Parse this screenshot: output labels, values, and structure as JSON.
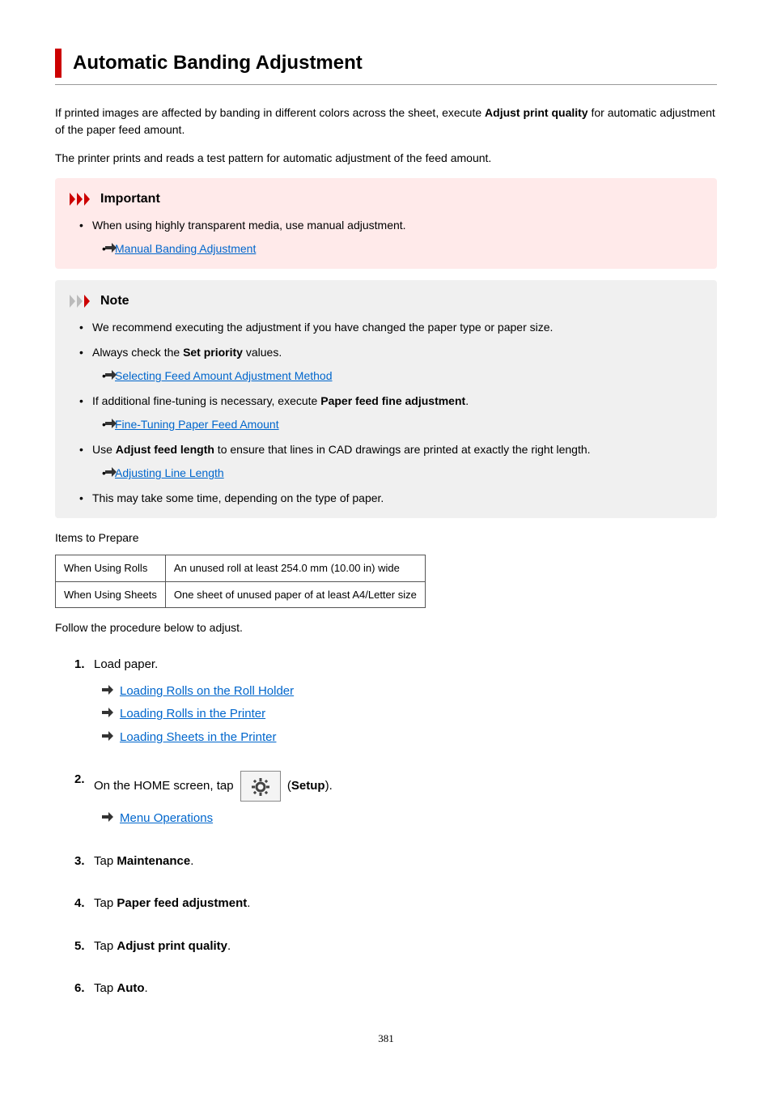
{
  "title": "Automatic Banding Adjustment",
  "intro1_a": "If printed images are affected by banding in different colors across the sheet, execute ",
  "intro1_b": "Adjust print quality",
  "intro1_c": " for automatic adjustment of the paper feed amount.",
  "intro2": "The printer prints and reads a test pattern for automatic adjustment of the feed amount.",
  "important": {
    "label": "Important",
    "item1": "When using highly transparent media, use manual adjustment.",
    "link1": "Manual Banding Adjustment"
  },
  "note": {
    "label": "Note",
    "item1": "We recommend executing the adjustment if you have changed the paper type or paper size.",
    "item2_a": "Always check the ",
    "item2_b": "Set priority",
    "item2_c": " values.",
    "link2": "Selecting Feed Amount Adjustment Method",
    "item3_a": "If additional fine-tuning is necessary, execute ",
    "item3_b": "Paper feed fine adjustment",
    "item3_c": ".",
    "link3": "Fine-Tuning Paper Feed Amount",
    "item4_a": "Use ",
    "item4_b": "Adjust feed length",
    "item4_c": " to ensure that lines in CAD drawings are printed at exactly the right length.",
    "link4": "Adjusting Line Length",
    "item5": "This may take some time, depending on the type of paper."
  },
  "items_prepare": "Items to Prepare",
  "table": {
    "r1c1": "When Using Rolls",
    "r1c2": "An unused roll at least 254.0 mm (10.00 in) wide",
    "r2c1": "When Using Sheets",
    "r2c2": "One sheet of unused paper of at least A4/Letter size"
  },
  "follow": "Follow the procedure below to adjust.",
  "steps": {
    "s1": "Load paper.",
    "s1_link1": "Loading Rolls on the Roll Holder",
    "s1_link2": "Loading Rolls in the Printer",
    "s1_link3": "Loading Sheets in the Printer",
    "s2_a": "On the HOME screen, tap ",
    "s2_b": "Setup",
    "s2_c": ").",
    "s2_link": "Menu Operations",
    "s3_a": "Tap ",
    "s3_b": "Maintenance",
    "s3_c": ".",
    "s4_a": "Tap ",
    "s4_b": "Paper feed adjustment",
    "s4_c": ".",
    "s5_a": "Tap ",
    "s5_b": "Adjust print quality",
    "s5_c": ".",
    "s6_a": "Tap ",
    "s6_b": "Auto",
    "s6_c": "."
  },
  "pagenum": "381"
}
